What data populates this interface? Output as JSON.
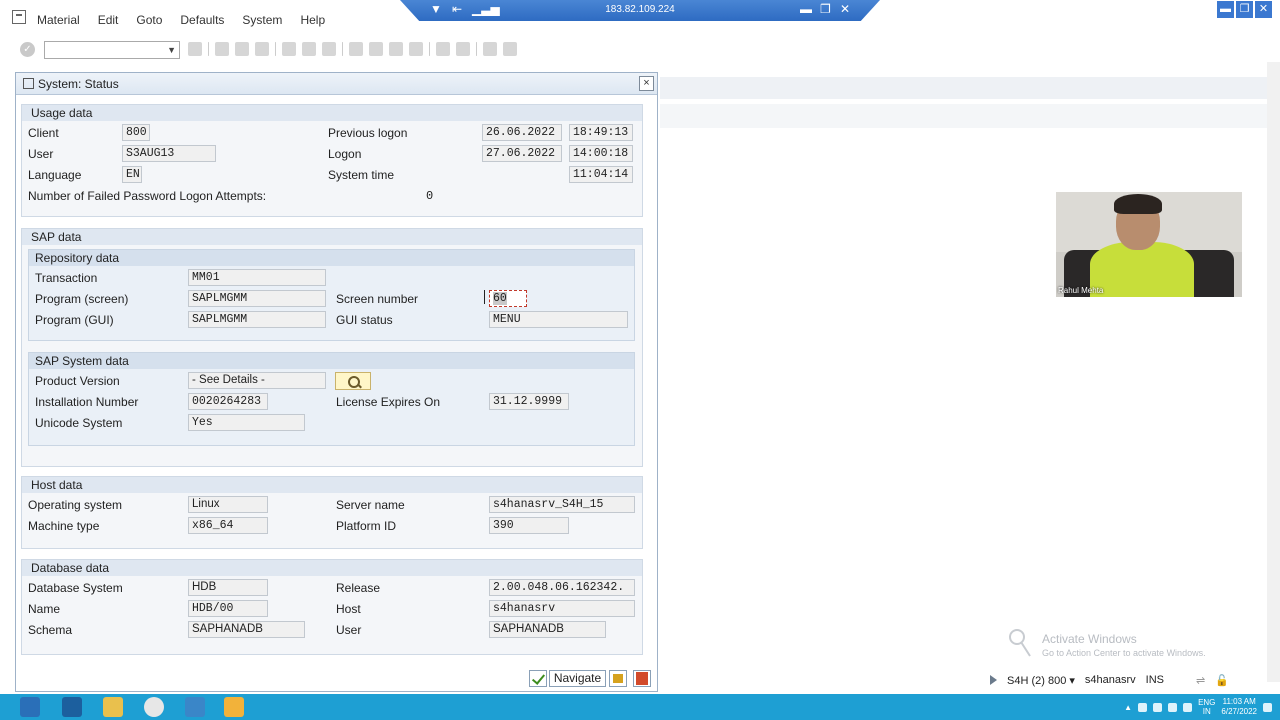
{
  "menu": [
    "Material",
    "Edit",
    "Goto",
    "Defaults",
    "System",
    "Help"
  ],
  "remote": {
    "ip": "183.82.109.224"
  },
  "dialog": {
    "title": "System: Status",
    "close": "×",
    "usage": {
      "header": "Usage data",
      "client_label": "Client",
      "client": "800",
      "user_label": "User",
      "user": "S3AUG13",
      "language_label": "Language",
      "language": "EN",
      "failed_label": "Number of Failed Password Logon Attempts:",
      "failed": "0",
      "prev_logon_label": "Previous logon",
      "prev_logon_date": "26.06.2022",
      "prev_logon_time": "18:49:13",
      "logon_label": "Logon",
      "logon_date": "27.06.2022",
      "logon_time": "14:00:18",
      "system_time_label": "System time",
      "system_time": "11:04:14"
    },
    "sap": {
      "header": "SAP data",
      "repo_header": "Repository data",
      "transaction_label": "Transaction",
      "transaction": "MM01",
      "program_screen_label": "Program (screen)",
      "program_screen": "SAPLMGMM",
      "program_gui_label": "Program (GUI)",
      "program_gui": "SAPLMGMM",
      "screen_number_label": "Screen number",
      "screen_number": "60",
      "gui_status_label": "GUI status",
      "gui_status": "MENU",
      "system_header": "SAP System data",
      "product_version_label": "Product Version",
      "product_version": "- See Details -",
      "installation_label": "Installation Number",
      "installation": "0020264283",
      "unicode_label": "Unicode System",
      "unicode": "Yes",
      "license_label": "License Expires On",
      "license": "31.12.9999"
    },
    "host": {
      "header": "Host data",
      "os_label": "Operating system",
      "os": "Linux",
      "machine_label": "Machine type",
      "machine": "x86_64",
      "server_label": "Server name",
      "server": "s4hanasrv_S4H_15",
      "platform_label": "Platform ID",
      "platform": "390"
    },
    "db": {
      "header": "Database data",
      "system_label": "Database System",
      "system": "HDB",
      "name_label": "Name",
      "name": "HDB/00",
      "schema_label": "Schema",
      "schema": "SAPHANADB",
      "release_label": "Release",
      "release": "2.00.048.06.162342.",
      "host_label": "Host",
      "host": "s4hanasrv",
      "user_label": "User",
      "user": "SAPHANADB"
    },
    "navigate": "Navigate"
  },
  "video": {
    "name": "Rahul Mehta"
  },
  "watermark": {
    "line1": "Activate Windows",
    "line2": "Go to Action Center to activate Windows."
  },
  "status": {
    "system": "S4H (2) 800",
    "server": "s4hanasrv",
    "mode": "INS"
  },
  "tray": {
    "lang1": "ENG",
    "lang2": "IN",
    "time": "11:03 AM",
    "date": "6/27/2022"
  },
  "colors": {
    "taskbar": "#1e9fd3",
    "title_bar": "#dde7f2",
    "group_header": "#dfe7f1"
  }
}
